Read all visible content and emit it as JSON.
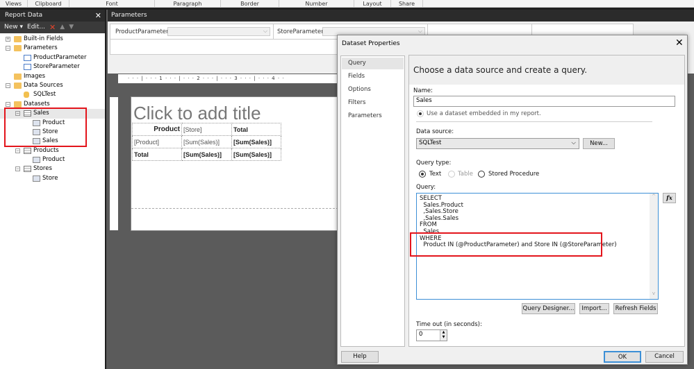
{
  "ribbon": {
    "groups": [
      "Views",
      "Clipboard",
      "Font",
      "Paragraph",
      "Border",
      "Number",
      "Layout",
      "Share"
    ]
  },
  "report_data": {
    "title": "Report Data",
    "close": "✕",
    "toolbar": {
      "new": "New",
      "edit": "Edit..."
    },
    "tree": [
      {
        "label": "Built-in Fields",
        "level": 0,
        "toggle": "+",
        "icon": "folder"
      },
      {
        "label": "Parameters",
        "level": 0,
        "toggle": "−",
        "icon": "folder"
      },
      {
        "label": "ProductParameter",
        "level": 1,
        "icon": "parameter"
      },
      {
        "label": "StoreParameter",
        "level": 1,
        "icon": "parameter"
      },
      {
        "label": "Images",
        "level": 0,
        "icon": "folder"
      },
      {
        "label": "Data Sources",
        "level": 0,
        "toggle": "−",
        "icon": "folder"
      },
      {
        "label": "SQLTest",
        "level": 1,
        "icon": "database"
      },
      {
        "label": "Datasets",
        "level": 0,
        "toggle": "−",
        "icon": "folder"
      },
      {
        "label": "Sales",
        "level": 1,
        "toggle": "−",
        "icon": "dataset",
        "selected": true
      },
      {
        "label": "Product",
        "level": 2,
        "icon": "field"
      },
      {
        "label": "Store",
        "level": 2,
        "icon": "field"
      },
      {
        "label": "Sales",
        "level": 2,
        "icon": "field"
      },
      {
        "label": "Products",
        "level": 1,
        "toggle": "−",
        "icon": "dataset"
      },
      {
        "label": "Product",
        "level": 2,
        "icon": "field"
      },
      {
        "label": "Stores",
        "level": 1,
        "toggle": "−",
        "icon": "dataset"
      },
      {
        "label": "Store",
        "level": 2,
        "icon": "field"
      }
    ]
  },
  "parameters_pane": {
    "title": "Parameters",
    "params": [
      {
        "label": "ProductParameter",
        "value": ""
      },
      {
        "label": "StoreParameter",
        "value": ""
      }
    ]
  },
  "ruler": "· · · | · · · 1 · · · | · · · 2 · · · | · · · 3 · · · | · · · 4 · ·",
  "report": {
    "title_placeholder": "Click to add title",
    "table": [
      [
        "Product",
        "[Store]",
        "Total"
      ],
      [
        "[Product]",
        "[Sum(Sales)]",
        "[Sum(Sales)]"
      ],
      [
        "Total",
        "[Sum(Sales)]",
        "[Sum(Sales)]"
      ]
    ]
  },
  "dialog": {
    "title": "Dataset Properties",
    "close": "✕",
    "nav": [
      "Query",
      "Fields",
      "Options",
      "Filters",
      "Parameters"
    ],
    "nav_selected": "Query",
    "header": "Choose a data source and create a query.",
    "name_label": "Name:",
    "name_value": "Sales",
    "embedded_option": "Use a dataset embedded in my report.",
    "data_source_label": "Data source:",
    "data_source_value": "SQLTest",
    "new_button": "New...",
    "query_type_label": "Query type:",
    "query_types": [
      "Text",
      "Table",
      "Stored Procedure"
    ],
    "query_type_selected": "Text",
    "query_label": "Query:",
    "query_text": "SELECT\n  Sales.Product\n  ,Sales.Store\n  ,Sales.Sales\nFROM\n  Sales\nWHERE\n  Product IN (@ProductParameter) and Store IN (@StoreParameter)",
    "fx_button": "fx",
    "query_designer_button": "Query Designer...",
    "import_button": "Import...",
    "refresh_fields_button": "Refresh Fields",
    "timeout_label": "Time out (in seconds):",
    "timeout_value": "0",
    "help_button": "Help",
    "ok_button": "OK",
    "cancel_button": "Cancel"
  },
  "colors": {
    "highlight": "#e3141b",
    "dark_panel": "#2b2b2b",
    "accent": "#3c8fd6"
  }
}
